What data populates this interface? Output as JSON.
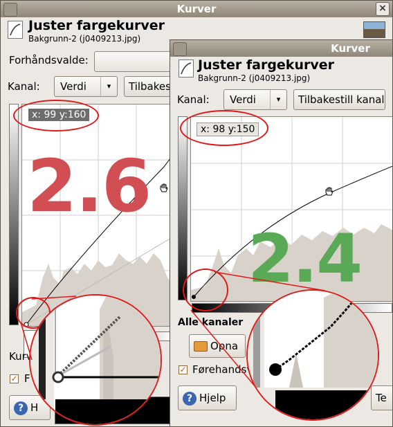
{
  "window_left": {
    "title": "Kurver",
    "close_label": "×",
    "header_title": "Juster fargekurver",
    "header_subtitle": "Bakgrunn-2 (j0409213.jpg)",
    "presets_label": "Forhåndsvalde:",
    "channel_label": "Kanal:",
    "channel_value": "Verdi",
    "reset_label": "Tilbakes",
    "coord_readout": "x: 99 y:160",
    "gamma_badge": "2.6",
    "curve_type_label": "Kurv",
    "preview_label": "F",
    "help_label": "H"
  },
  "window_right": {
    "title": "Kurver",
    "header_title": "Juster fargekurver",
    "header_subtitle": "Bakgrunn-2 (j0409213.jpg)",
    "channel_label": "Kanal:",
    "channel_value": "Verdi",
    "reset_label": "Tilbakestill kanal",
    "coord_readout": "x: 98 y:150",
    "gamma_badge": "2.4",
    "all_channels_label": "Alle kanaler",
    "open_label": "Opna",
    "preview_label": "Førehandsv",
    "help_label": "Hjelp",
    "extra_button_label": "Te"
  },
  "colors": {
    "annotation_red": "#e01818",
    "badge_red": "#d14f52",
    "badge_green": "#5aa957",
    "histogram": "#d8d2ca",
    "titlebar": "#9a9183"
  },
  "icons": {
    "dialog_icon": "curves-dialog-icon",
    "close_icon": "close-icon",
    "help_icon": "help-icon",
    "open_icon": "folder-open-icon",
    "hand_cursor": "hand-cursor-icon",
    "image_thumbnail": "image-thumbnail"
  }
}
